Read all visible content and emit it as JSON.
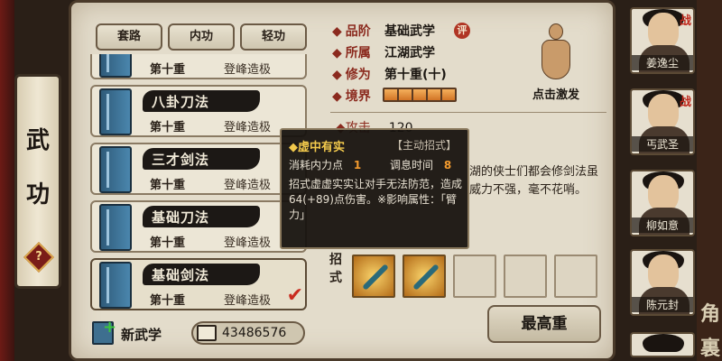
{
  "sidebar": {
    "title_1": "武",
    "title_2": "功",
    "help_icon": "question-icon",
    "help_label": "?"
  },
  "tabs": [
    {
      "label": "套路"
    },
    {
      "label": "内功"
    },
    {
      "label": "轻功"
    }
  ],
  "skills": [
    {
      "name": "",
      "level": "第十重",
      "grade": "登峰造极"
    },
    {
      "name": "八卦刀法",
      "level": "第十重",
      "grade": "登峰造极"
    },
    {
      "name": "三才剑法",
      "level": "第十重",
      "grade": "登峰造极"
    },
    {
      "name": "基础刀法",
      "level": "第十重",
      "grade": "登峰造极"
    },
    {
      "name": "基础剑法",
      "level": "第十重",
      "grade": "登峰造极"
    }
  ],
  "selected_check": "✔",
  "bottom": {
    "new_skill_label": "新武学",
    "currency_value": "43486576",
    "max_level_button": "最高重"
  },
  "info": {
    "rank_label": "品阶",
    "rank_value": "基础武学",
    "eval_badge": "评",
    "school_label": "所属",
    "school_value": "江湖武学",
    "cultivation_label": "修为",
    "cultivation_value": "第十重(十)",
    "realm_label": "境界",
    "realm_segments": 5,
    "meditate_label": "点击激发"
  },
  "stats": {
    "attack_label": "攻击",
    "attack_value": "120",
    "description_visible": "湖的侠士们都会修剑法虽威力不强，毫不花哨。"
  },
  "moves_label": "招式",
  "tooltip": {
    "name": "◆虚中有实",
    "type": "【主动招式】",
    "cost_label": "消耗内力点",
    "cost_value": "1",
    "cooldown_label": "调息时间",
    "cooldown_value": "8",
    "description": "招式虚虚实实让对手无法防范，造成64(+89)点伤害。※影响属性：「臂力」"
  },
  "characters": [
    {
      "name": "姜逸尘",
      "battle": "战"
    },
    {
      "name": "丐武圣",
      "battle": "战"
    },
    {
      "name": "柳如意",
      "battle": ""
    },
    {
      "name": "陈元封",
      "battle": ""
    },
    {
      "name": "",
      "battle": ""
    }
  ],
  "right_chars": [
    "角",
    "裏"
  ]
}
